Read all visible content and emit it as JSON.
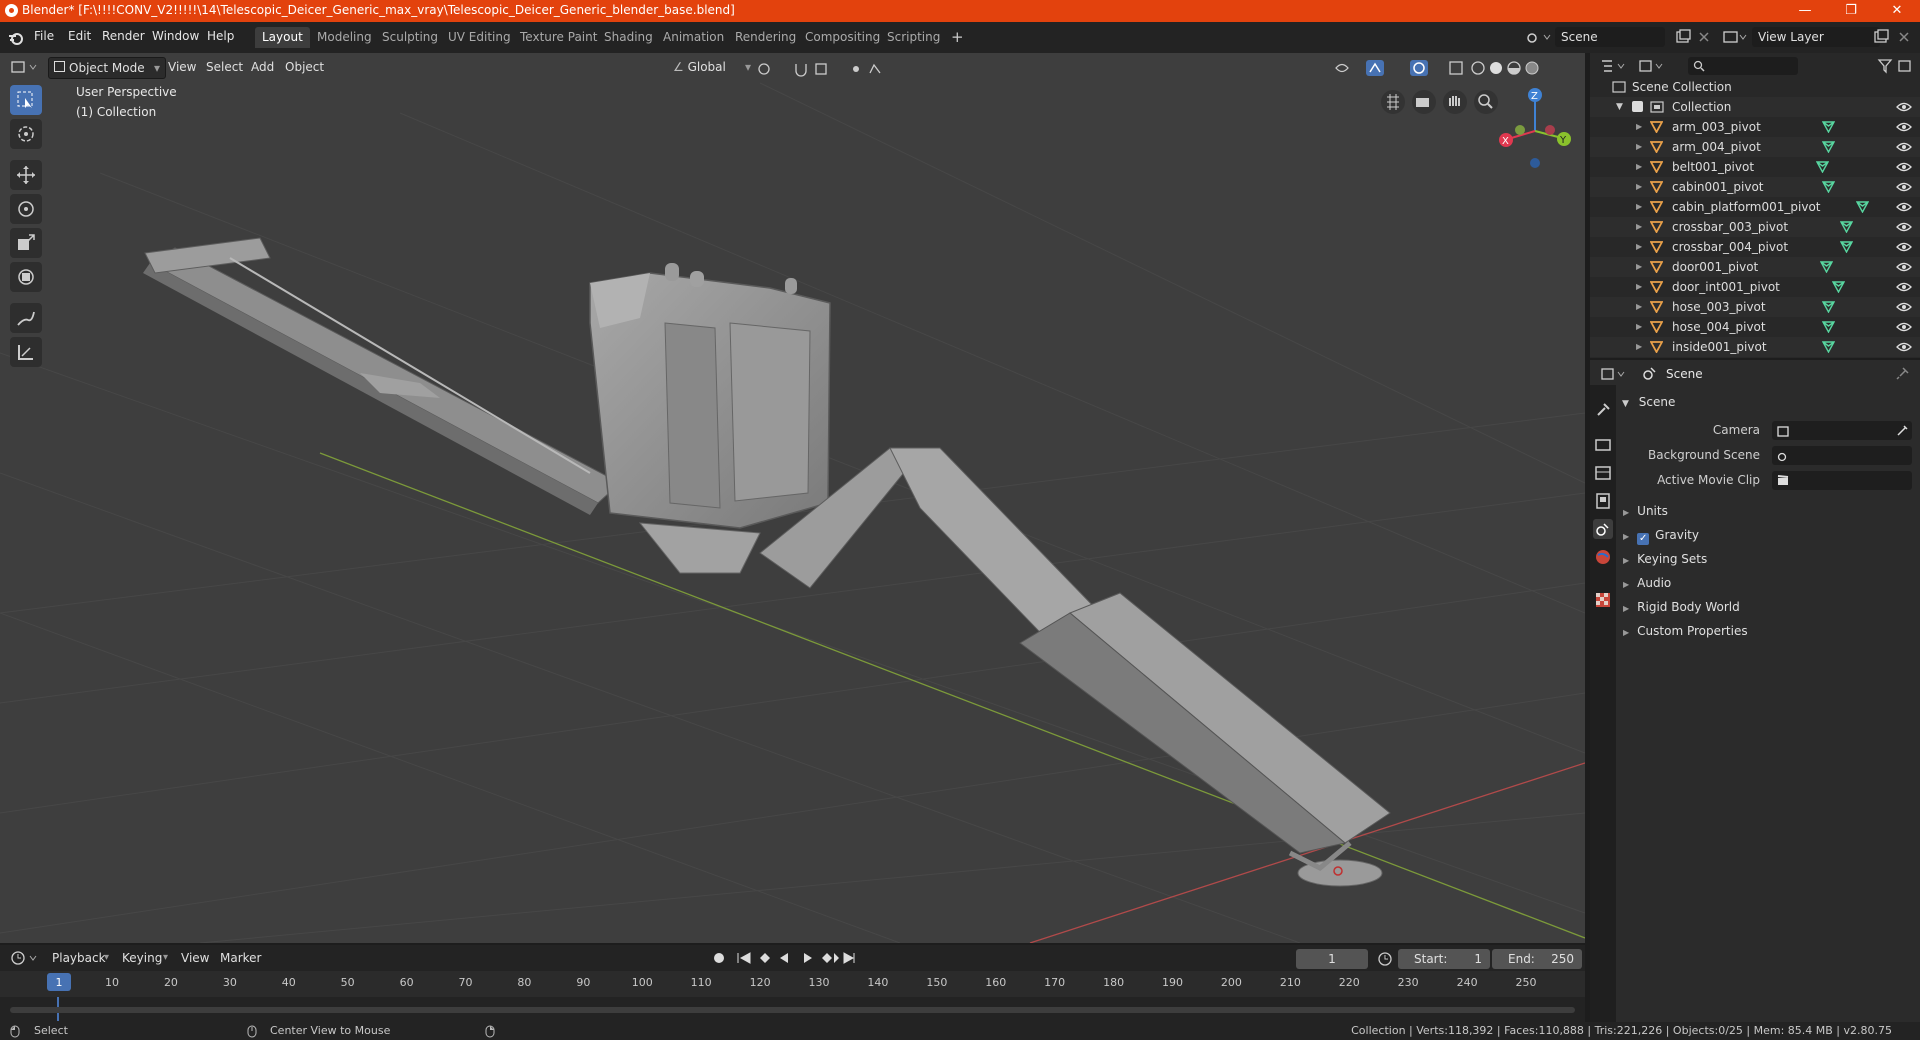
{
  "title_bar": {
    "title": "Blender* [F:\\!!!!CONV_V2!!!!!\\14\\Telescopic_Deicer_Generic_max_vray\\Telescopic_Deicer_Generic_blender_base.blend]",
    "minimize": "—",
    "maximize": "❐",
    "close": "✕"
  },
  "menu": {
    "items": [
      "File",
      "Edit",
      "Render",
      "Window",
      "Help"
    ]
  },
  "workspaces": [
    "Layout",
    "Modeling",
    "Sculpting",
    "UV Editing",
    "Texture Paint",
    "Shading",
    "Animation",
    "Rendering",
    "Compositing",
    "Scripting"
  ],
  "add_workspace": "+",
  "scene_selector": {
    "value": "Scene"
  },
  "view_layer_selector": {
    "value": "View Layer"
  },
  "viewport": {
    "mode": "Object Mode",
    "menus": [
      "View",
      "Select",
      "Add",
      "Object"
    ],
    "orientation": "Global",
    "overlay_text": "User Perspective",
    "overlay_collection": "(1) Collection",
    "gizmo": {
      "x": "X",
      "y": "Y",
      "z": "Z"
    }
  },
  "outliner": {
    "search_placeholder": "",
    "root": "Scene Collection",
    "collection": "Collection",
    "objects": [
      "arm_003_pivot",
      "arm_004_pivot",
      "belt001_pivot",
      "cabin001_pivot",
      "cabin_platform001_pivot",
      "crossbar_003_pivot",
      "crossbar_004_pivot",
      "door001_pivot",
      "door_int001_pivot",
      "hose_003_pivot",
      "hose_004_pivot",
      "inside001_pivot"
    ]
  },
  "properties": {
    "context": "Scene",
    "section": "Scene",
    "fields": [
      {
        "label": "Camera"
      },
      {
        "label": "Background Scene"
      },
      {
        "label": "Active Movie Clip"
      }
    ],
    "panels": [
      "Units",
      "Gravity",
      "Keying Sets",
      "Audio",
      "Rigid Body World",
      "Custom Properties"
    ],
    "gravity_checked": true
  },
  "timeline": {
    "menus": [
      "Playback",
      "Keying",
      "View",
      "Marker"
    ],
    "current_frame": "1",
    "start_label": "Start:",
    "start": "1",
    "end_label": "End:",
    "end": "250",
    "ruler": [
      "1",
      "10",
      "20",
      "30",
      "40",
      "50",
      "60",
      "70",
      "80",
      "90",
      "100",
      "110",
      "120",
      "130",
      "140",
      "150",
      "160",
      "170",
      "180",
      "190",
      "200",
      "210",
      "220",
      "230",
      "240",
      "250"
    ]
  },
  "statusbar": {
    "left": "Select",
    "middle": "Center View to Mouse",
    "right": "Collection | Verts:118,392 | Faces:110,888 | Tris:221,226 | Objects:0/25 | Mem: 85.4 MB | v2.80.75"
  },
  "colors": {
    "title_bar": "#e3420d",
    "accent": "#4772b3",
    "viewport_bg": "#3e3e3e",
    "mesh_icon": "#e9a14a",
    "data_icon": "#58d6a0"
  }
}
